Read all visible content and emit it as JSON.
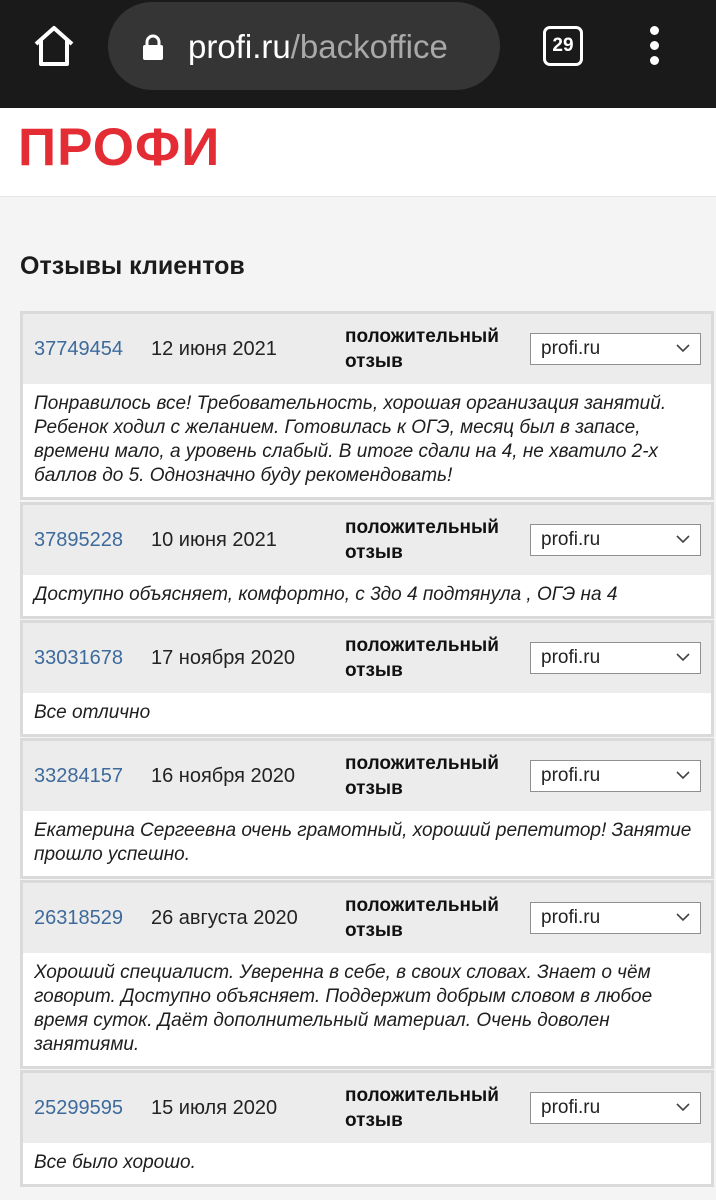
{
  "browser": {
    "url_domain": "profi.ru",
    "url_path": "/backoffice",
    "tab_count": "29"
  },
  "site": {
    "logo": "ПРОФИ"
  },
  "page": {
    "title": "Отзывы клиентов"
  },
  "reviews": [
    {
      "id": "37749454",
      "date": "12 июня 2021",
      "type": "положительный отзыв",
      "source": "profi.ru",
      "text": "Понравилось все! Требовательность, хорошая организация занятий. Ребенок ходил с желанием. Готовилась к ОГЭ, месяц был в запасе, времени мало, а уровень слабый. В итоге сдали на 4, не хватило 2-х баллов до 5. Однозначно буду рекомендовать!"
    },
    {
      "id": "37895228",
      "date": "10 июня 2021",
      "type": "положительный отзыв",
      "source": "profi.ru",
      "text": "Доступно объясняет, комфортно, с 3до 4 подтянула , ОГЭ на 4"
    },
    {
      "id": "33031678",
      "date": "17 ноября 2020",
      "type": "положительный отзыв",
      "source": "profi.ru",
      "text": "Все отлично"
    },
    {
      "id": "33284157",
      "date": "16 ноября 2020",
      "type": "положительный отзыв",
      "source": "profi.ru",
      "text": "Екатерина Сергеевна очень грамотный, хороший репетитор! Занятие прошло успешно."
    },
    {
      "id": "26318529",
      "date": "26 августа 2020",
      "type": "положительный отзыв",
      "source": "profi.ru",
      "text": "Хороший специалист. Уверенна в себе, в своих словах. Знает о чём говорит. Доступно объясняет. Поддержит добрым словом в любое время суток. Даёт дополнительный материал. Очень доволен занятиями."
    },
    {
      "id": "25299595",
      "date": "15 июля 2020",
      "type": "положительный отзыв",
      "source": "profi.ru",
      "text": "Все было хорошо."
    }
  ],
  "icons": [
    "home-icon",
    "lock-icon",
    "tabs-icon",
    "more-vert-icon",
    "chevron-down-icon"
  ],
  "colors": {
    "brand": "#e42c34",
    "link": "#3d6a9c",
    "browser_bar": "#1a1a1a"
  }
}
